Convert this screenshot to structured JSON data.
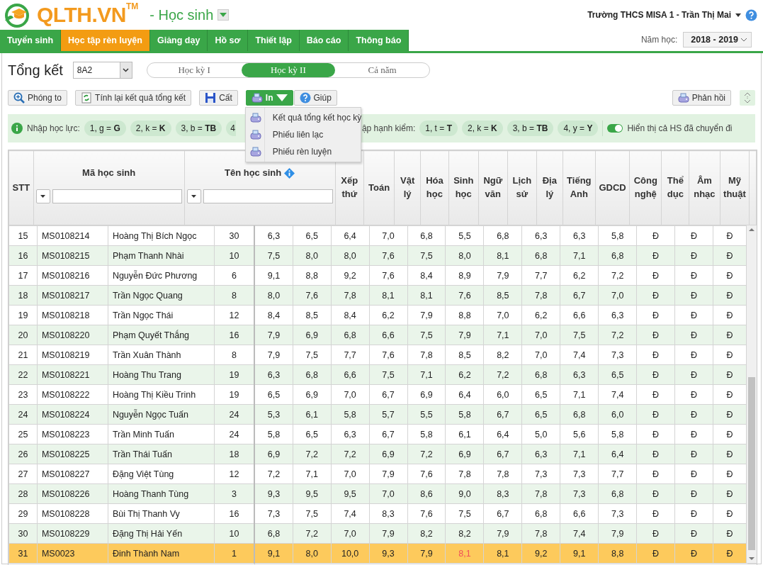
{
  "header": {
    "logo": "QLTH.VN",
    "trademark": "TM",
    "module": "- Học sinh",
    "user": "Trường THCS MISA 1 - Trần Thị Mai"
  },
  "nav": {
    "tabs": [
      {
        "label": "Tuyển sinh",
        "selected": false
      },
      {
        "label": "Học tập rèn luyện",
        "selected": true
      },
      {
        "label": "Giảng dạy",
        "selected": false
      },
      {
        "label": "Hồ sơ",
        "selected": false
      },
      {
        "label": "Thiết lập",
        "selected": false
      },
      {
        "label": "Báo cáo",
        "selected": false
      },
      {
        "label": "Thông báo",
        "selected": false
      }
    ],
    "year_label": "Năm học:",
    "year": "2018 - 2019"
  },
  "page": {
    "title": "Tổng kết",
    "class": "8A2",
    "terms": [
      {
        "label": "Học kỳ I",
        "selected": false
      },
      {
        "label": "Học kỳ II",
        "selected": true
      },
      {
        "label": "Cả năm",
        "selected": false
      }
    ]
  },
  "toolbar": {
    "buttons": [
      {
        "kind": "zoom",
        "label": "Phóng to",
        "open": false
      },
      {
        "kind": "recalc",
        "label": "Tính lại kết quả tổng kết",
        "open": false
      },
      {
        "kind": "save",
        "label": "Cất",
        "open": false
      },
      {
        "kind": "print",
        "label": "In",
        "open": true
      },
      {
        "kind": "help",
        "label": "Giúp",
        "open": false
      }
    ],
    "feedback": "Phản hồi"
  },
  "print_menu": [
    {
      "label": "Kết quả tổng kết học kỳ"
    },
    {
      "label": "Phiếu liên lạc"
    },
    {
      "label": "Phiếu rèn luyện"
    }
  ],
  "filter_bar": {
    "groups": [
      {
        "label": "Nhập học lực:",
        "chips": [
          "1, g = **G**",
          "2, k = **K**",
          "3, b = **TB**",
          "4"
        ]
      },
      {
        "label": "ập hạnh kiểm:",
        "chips": [
          "1, t = **T**",
          "2, k = **K**",
          "3, b = **TB**",
          "4, y = **Y**"
        ]
      }
    ],
    "toggle": {
      "label": "Hiển thị cả HS đã chuyển đi",
      "on": true
    }
  },
  "table": {
    "columns": [
      {
        "label": "STT",
        "filter": false
      },
      {
        "label": "Mã học sinh",
        "filter": true
      },
      {
        "label": "Tên học sinh",
        "filter": true,
        "info": true
      },
      {
        "label": "Xếp thứ",
        "filter": false
      },
      {
        "label": "Toán",
        "filter": false
      },
      {
        "label": "Vật lý",
        "filter": false
      },
      {
        "label": "Hóa học",
        "filter": false
      },
      {
        "label": "Sinh học",
        "filter": false
      },
      {
        "label": "Ngữ văn",
        "filter": false
      },
      {
        "label": "Lịch sử",
        "filter": false
      },
      {
        "label": "Địa lý",
        "filter": false
      },
      {
        "label": "Tiếng Anh",
        "filter": false
      },
      {
        "label": "GDCD",
        "filter": false
      },
      {
        "label": "Công nghệ",
        "filter": false
      },
      {
        "label": "Thể dục",
        "filter": false
      },
      {
        "label": "Âm nhạc",
        "filter": false
      },
      {
        "label": "Mỹ thuật",
        "filter": false
      }
    ],
    "rows": [
      {
        "stt": "15",
        "code": "MS0108214",
        "name": "Hoàng Thị Bích Ngọc",
        "rank": "30",
        "scores": [
          "6,3",
          "6,5",
          "6,4",
          "7,0",
          "6,8",
          "5,5",
          "6,8",
          "6,3",
          "6,3",
          "5,8",
          "Đ",
          "Đ",
          "Đ"
        ],
        "alerts": [
          false,
          false,
          false,
          false,
          false,
          false,
          false,
          false,
          false,
          false,
          false,
          false,
          false
        ],
        "selected": false
      },
      {
        "stt": "16",
        "code": "MS0108215",
        "name": "Phạm Thanh Nhài",
        "rank": "10",
        "scores": [
          "7,5",
          "8,0",
          "8,0",
          "7,6",
          "7,5",
          "8,0",
          "8,1",
          "6,8",
          "7,1",
          "6,8",
          "Đ",
          "Đ",
          "Đ"
        ],
        "alerts": [
          false,
          false,
          false,
          false,
          false,
          false,
          false,
          false,
          false,
          false,
          false,
          false,
          false
        ],
        "selected": false
      },
      {
        "stt": "17",
        "code": "MS0108216",
        "name": "Nguyễn Đức Phương",
        "rank": "6",
        "scores": [
          "9,1",
          "8,8",
          "9,2",
          "7,6",
          "8,4",
          "8,9",
          "7,9",
          "7,7",
          "6,2",
          "7,2",
          "Đ",
          "Đ",
          "Đ"
        ],
        "alerts": [
          false,
          false,
          false,
          false,
          false,
          false,
          false,
          false,
          false,
          false,
          false,
          false,
          false
        ],
        "selected": false
      },
      {
        "stt": "18",
        "code": "MS0108217",
        "name": "Trần Ngọc Quang",
        "rank": "8",
        "scores": [
          "8,0",
          "7,6",
          "7,8",
          "8,1",
          "8,1",
          "7,6",
          "8,5",
          "7,8",
          "6,7",
          "7,0",
          "Đ",
          "Đ",
          "Đ"
        ],
        "alerts": [
          false,
          false,
          false,
          false,
          false,
          false,
          false,
          false,
          false,
          false,
          false,
          false,
          false
        ],
        "selected": false
      },
      {
        "stt": "19",
        "code": "MS0108218",
        "name": "Trần Ngọc Thái",
        "rank": "12",
        "scores": [
          "8,4",
          "8,5",
          "8,4",
          "6,2",
          "7,9",
          "8,8",
          "7,0",
          "6,2",
          "6,6",
          "6,3",
          "Đ",
          "Đ",
          "Đ"
        ],
        "alerts": [
          false,
          false,
          false,
          false,
          false,
          false,
          false,
          false,
          false,
          false,
          false,
          false,
          false
        ],
        "selected": false
      },
      {
        "stt": "20",
        "code": "MS0108220",
        "name": "Phạm Quyết Thắng",
        "rank": "16",
        "scores": [
          "7,9",
          "6,9",
          "6,8",
          "6,6",
          "7,5",
          "7,9",
          "7,1",
          "7,0",
          "7,5",
          "7,2",
          "Đ",
          "Đ",
          "Đ"
        ],
        "alerts": [
          false,
          false,
          false,
          false,
          false,
          false,
          false,
          false,
          false,
          false,
          false,
          false,
          false
        ],
        "selected": false
      },
      {
        "stt": "21",
        "code": "MS0108219",
        "name": "Trần Xuân Thành",
        "rank": "8",
        "scores": [
          "7,9",
          "7,5",
          "7,7",
          "7,6",
          "7,8",
          "8,5",
          "8,2",
          "7,0",
          "7,4",
          "7,3",
          "Đ",
          "Đ",
          "Đ"
        ],
        "alerts": [
          false,
          false,
          false,
          false,
          false,
          false,
          false,
          false,
          false,
          false,
          false,
          false,
          false
        ],
        "selected": false
      },
      {
        "stt": "22",
        "code": "MS0108221",
        "name": "Hoàng Thu Trang",
        "rank": "19",
        "scores": [
          "6,3",
          "6,8",
          "6,6",
          "7,5",
          "7,1",
          "6,2",
          "7,2",
          "6,8",
          "6,3",
          "6,5",
          "Đ",
          "Đ",
          "Đ"
        ],
        "alerts": [
          false,
          false,
          false,
          false,
          false,
          false,
          false,
          false,
          false,
          false,
          false,
          false,
          false
        ],
        "selected": false
      },
      {
        "stt": "23",
        "code": "MS0108222",
        "name": "Hoàng Thị Kiều Trinh",
        "rank": "19",
        "scores": [
          "6,5",
          "6,9",
          "7,0",
          "6,7",
          "6,9",
          "6,4",
          "6,0",
          "6,5",
          "7,1",
          "7,4",
          "Đ",
          "Đ",
          "Đ"
        ],
        "alerts": [
          false,
          false,
          false,
          false,
          false,
          false,
          false,
          false,
          false,
          false,
          false,
          false,
          false
        ],
        "selected": false
      },
      {
        "stt": "24",
        "code": "MS0108224",
        "name": "Nguyễn Ngọc Tuấn",
        "rank": "24",
        "scores": [
          "5,3",
          "6,1",
          "5,8",
          "5,7",
          "5,5",
          "5,8",
          "6,7",
          "6,5",
          "6,8",
          "6,0",
          "Đ",
          "Đ",
          "Đ"
        ],
        "alerts": [
          false,
          false,
          false,
          false,
          false,
          false,
          false,
          false,
          false,
          false,
          false,
          false,
          false
        ],
        "selected": false
      },
      {
        "stt": "25",
        "code": "MS0108223",
        "name": "Trần Minh Tuấn",
        "rank": "24",
        "scores": [
          "5,8",
          "6,5",
          "6,3",
          "6,7",
          "5,8",
          "6,1",
          "6,4",
          "5,0",
          "5,6",
          "5,8",
          "Đ",
          "Đ",
          "Đ"
        ],
        "alerts": [
          false,
          false,
          false,
          false,
          false,
          false,
          false,
          false,
          false,
          false,
          false,
          false,
          false
        ],
        "selected": false
      },
      {
        "stt": "26",
        "code": "MS0108225",
        "name": "Trần Thái Tuấn",
        "rank": "18",
        "scores": [
          "6,9",
          "7,2",
          "7,2",
          "6,9",
          "7,2",
          "6,9",
          "6,7",
          "6,3",
          "7,1",
          "6,4",
          "Đ",
          "Đ",
          "Đ"
        ],
        "alerts": [
          false,
          false,
          false,
          false,
          false,
          false,
          false,
          false,
          false,
          false,
          false,
          false,
          false
        ],
        "selected": false
      },
      {
        "stt": "27",
        "code": "MS0108227",
        "name": "Đặng Việt Tùng",
        "rank": "12",
        "scores": [
          "7,2",
          "7,1",
          "7,0",
          "7,9",
          "7,6",
          "7,8",
          "7,8",
          "7,3",
          "7,3",
          "7,7",
          "Đ",
          "Đ",
          "Đ"
        ],
        "alerts": [
          false,
          false,
          false,
          false,
          false,
          false,
          false,
          false,
          false,
          false,
          false,
          false,
          false
        ],
        "selected": false
      },
      {
        "stt": "28",
        "code": "MS0108226",
        "name": "Hoàng Thanh Tùng",
        "rank": "3",
        "scores": [
          "9,3",
          "9,5",
          "9,5",
          "7,0",
          "8,6",
          "9,0",
          "8,3",
          "7,8",
          "7,3",
          "6,8",
          "Đ",
          "Đ",
          "Đ"
        ],
        "alerts": [
          false,
          false,
          false,
          false,
          false,
          false,
          false,
          false,
          false,
          false,
          false,
          false,
          false
        ],
        "selected": false
      },
      {
        "stt": "29",
        "code": "MS0108228",
        "name": "Bùi Thị Thanh Vy",
        "rank": "16",
        "scores": [
          "7,3",
          "7,5",
          "7,4",
          "8,3",
          "7,6",
          "7,5",
          "6,7",
          "6,8",
          "6,6",
          "7,3",
          "Đ",
          "Đ",
          "Đ"
        ],
        "alerts": [
          false,
          false,
          false,
          false,
          false,
          false,
          false,
          false,
          false,
          false,
          false,
          false,
          false
        ],
        "selected": false
      },
      {
        "stt": "30",
        "code": "MS0108229",
        "name": "Đặng Thị Hải Yến",
        "rank": "10",
        "scores": [
          "6,8",
          "7,2",
          "7,0",
          "7,9",
          "8,2",
          "8,2",
          "7,9",
          "7,8",
          "7,4",
          "7,9",
          "Đ",
          "Đ",
          "Đ"
        ],
        "alerts": [
          false,
          false,
          false,
          false,
          false,
          false,
          false,
          false,
          false,
          false,
          false,
          false,
          false
        ],
        "selected": false
      },
      {
        "stt": "31",
        "code": "MS0023",
        "name": "Đinh Thành Nam",
        "rank": "1",
        "scores": [
          "9,1",
          "8,0",
          "10,0",
          "9,3",
          "7,9",
          "8,1",
          "8,1",
          "9,2",
          "9,1",
          "8,8",
          "Đ",
          "Đ",
          "Đ"
        ],
        "alerts": [
          false,
          false,
          false,
          false,
          false,
          true,
          false,
          false,
          false,
          false,
          false,
          false,
          false
        ],
        "selected": true
      }
    ]
  }
}
